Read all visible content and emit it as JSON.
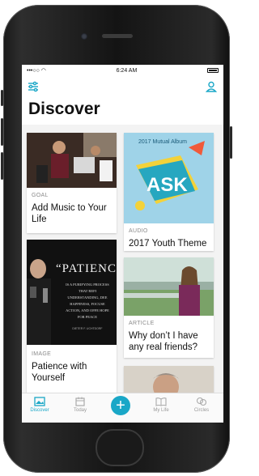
{
  "status_bar": {
    "signal": "•••○○",
    "time": "6:24 AM"
  },
  "header": {
    "title": "Discover"
  },
  "cards": [
    {
      "type": "GOAL",
      "title": "Add Music to Your Life"
    },
    {
      "type": "AUDIO",
      "title": "2017 Youth Theme",
      "image_text": {
        "album": "2017 Mutual Album",
        "word": "ASK"
      }
    },
    {
      "type": "IMAGE",
      "title": "Patience with Yourself",
      "image_text": {
        "word": "“PATIENC",
        "quote": "IS A PURIFYING PROCESS THAT REFI UNDERSTANDING, DEE HAPPINESS, FOCUSE ACTION, AND OFFE HOPE FOR PEACE",
        "author": "DIETER F. UCHTDORF"
      }
    },
    {
      "type": "ARTICLE",
      "title": "Why don’t I have any real friends?"
    }
  ],
  "tabs": [
    {
      "label": "Discover",
      "icon": "discover-icon"
    },
    {
      "label": "Today",
      "icon": "calendar-icon"
    },
    {
      "label": "",
      "icon": "plus-icon"
    },
    {
      "label": "My Life",
      "icon": "book-icon"
    },
    {
      "label": "Circles",
      "icon": "circles-icon"
    }
  ],
  "colors": {
    "accent": "#1aa7c7",
    "screen_background": "#f3f3f3"
  }
}
